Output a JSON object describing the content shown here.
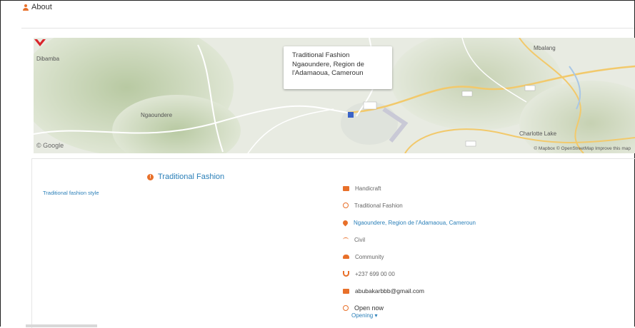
{
  "header": {
    "title": "About",
    "icon": "user-icon"
  },
  "map": {
    "popup": {
      "title": "Traditional Fashion",
      "address_line1": "Ngaoundere, Region de",
      "address_line2": "l'Adamaoua, Cameroun"
    },
    "labels": [
      "Mbalang",
      "Dibamba",
      "Ngaoundere",
      "Charlotte Lake"
    ],
    "attribution": "© Mapbox © OpenStreetMap Improve this map",
    "brand": "© Google",
    "colors": {
      "marker": "#d9252b",
      "road": "#f2c96b",
      "water": "#a9c7e6"
    }
  },
  "business": {
    "name": "Traditional Fashion",
    "left_link": "Traditional fashion style",
    "details": [
      {
        "icon": "briefcase-icon",
        "text": "Handicraft",
        "kind": "plain"
      },
      {
        "icon": "search-icon",
        "text": "Traditional Fashion",
        "kind": "plain"
      },
      {
        "icon": "map-pin-icon",
        "text": "Ngaoundere, Region de l'Adamaoua, Cameroun",
        "kind": "loc"
      },
      {
        "icon": "wifi-icon",
        "text": "Civil",
        "kind": "plain"
      },
      {
        "icon": "users-icon",
        "text": "Community",
        "kind": "plain"
      },
      {
        "icon": "phone-icon",
        "text": "+237 699 00 00",
        "kind": "plain"
      },
      {
        "icon": "mail-icon",
        "text": "abubakarbbb@gmail.com",
        "kind": "email"
      },
      {
        "icon": "clock-icon",
        "text": "Open now",
        "kind": "open"
      }
    ],
    "hours_toggle": "Opening ▾"
  }
}
